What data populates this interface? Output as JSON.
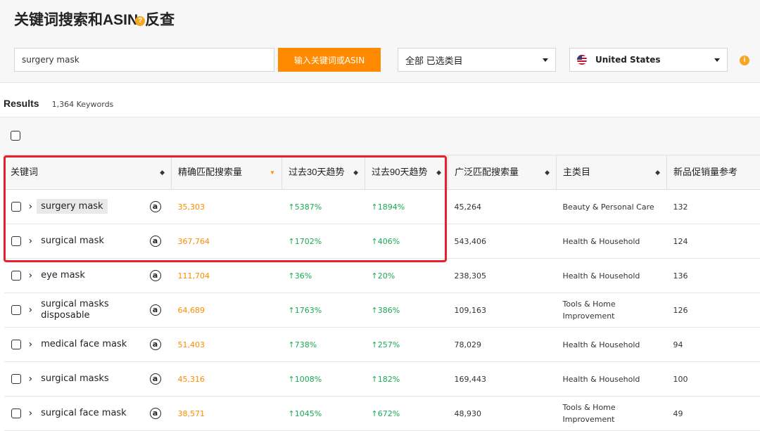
{
  "header": {
    "title_part1": "关键词搜索和ASIN",
    "title_part2": "反查",
    "help_glyph": "?"
  },
  "search": {
    "value": "surgery mask",
    "button_label": "输入关键词或ASIN"
  },
  "filters": {
    "category": "全部 已选类目",
    "country": "United States",
    "info_glyph": "i"
  },
  "results": {
    "label": "Results",
    "count": "1,364 Keywords"
  },
  "table": {
    "headers": {
      "keyword": "关键词",
      "exact": "精确匹配搜索量",
      "trend30": "过去30天趋势",
      "trend90": "过去90天趋势",
      "broad": "广泛匹配搜索量",
      "category": "主类目",
      "newprod": "新品促销量参考"
    },
    "amazon_glyph": "a",
    "rows": [
      {
        "keyword": "surgery mask",
        "exact": "35,303",
        "trend30": "↑5387%",
        "trend90": "↑1894%",
        "broad": "45,264",
        "category": "Beauty & Personal Care",
        "newprod": "132"
      },
      {
        "keyword": "surgical mask",
        "exact": "367,764",
        "trend30": "↑1702%",
        "trend90": "↑406%",
        "broad": "543,406",
        "category": "Health & Household",
        "newprod": "124"
      },
      {
        "keyword": "eye mask",
        "exact": "111,704",
        "trend30": "↑36%",
        "trend90": "↑20%",
        "broad": "238,305",
        "category": "Health & Household",
        "newprod": "136"
      },
      {
        "keyword": "surgical masks disposable",
        "exact": "64,689",
        "trend30": "↑1763%",
        "trend90": "↑386%",
        "broad": "109,163",
        "category": "Tools & Home Improvement",
        "newprod": "126"
      },
      {
        "keyword": "medical face mask",
        "exact": "51,403",
        "trend30": "↑738%",
        "trend90": "↑257%",
        "broad": "78,029",
        "category": "Health & Household",
        "newprod": "94"
      },
      {
        "keyword": "surgical masks",
        "exact": "45,316",
        "trend30": "↑1008%",
        "trend90": "↑182%",
        "broad": "169,443",
        "category": "Health & Household",
        "newprod": "100"
      },
      {
        "keyword": "surgical face mask",
        "exact": "38,571",
        "trend30": "↑1045%",
        "trend90": "↑672%",
        "broad": "48,930",
        "category": "Tools & Home Improvement",
        "newprod": "49"
      }
    ]
  },
  "colors": {
    "accent_orange": "#ff8a00",
    "trend_green": "#1aaa55",
    "highlight_red": "#e8202a"
  }
}
